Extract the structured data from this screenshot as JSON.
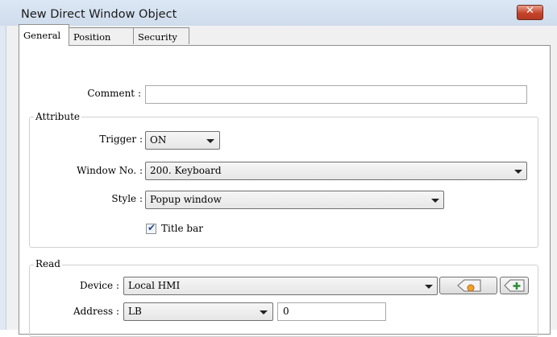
{
  "window": {
    "title": "New Direct Window Object",
    "close_glyph": "✕"
  },
  "tabs": [
    {
      "label": "General",
      "active": true
    },
    {
      "label": "Position",
      "active": false
    },
    {
      "label": "Security",
      "active": false
    }
  ],
  "general": {
    "comment": {
      "label": "Comment :",
      "value": ""
    },
    "attribute": {
      "group_title": "Attribute",
      "trigger": {
        "label": "Trigger :",
        "value": "ON"
      },
      "window_no": {
        "label": "Window No. :",
        "value": "200. Keyboard"
      },
      "style": {
        "label": "Style :",
        "value": "Popup window"
      },
      "title_bar": {
        "label": "Title bar",
        "checked": true,
        "check_glyph": "✔"
      }
    },
    "read": {
      "group_title": "Read",
      "device": {
        "label": "Device :",
        "value": "Local HMI"
      },
      "address": {
        "label": "Address :",
        "type": "LB",
        "value": "0"
      },
      "settings_button_icon": "tag-settings-icon",
      "add_button_icon": "add-address-icon"
    }
  },
  "colors": {
    "close_button": "#c5432a",
    "titlebar": "#dbe7f4",
    "accent_orange": "#f0a030",
    "accent_green": "#2e8b3a"
  }
}
